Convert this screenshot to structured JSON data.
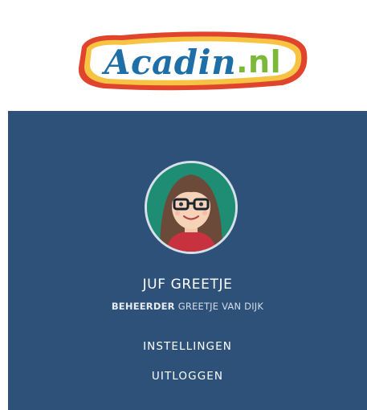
{
  "logo": {
    "brand_main": "Acadin",
    "brand_tld": ".nl"
  },
  "user": {
    "avatar_alt": "Juf Greetje avatar",
    "display_name": "JUF GREETJE",
    "role": "BEHEERDER",
    "full_name": "GREETJE VAN DIJK"
  },
  "menu": {
    "settings_label": "INSTELLINGEN",
    "logout_label": "UITLOGGEN"
  },
  "colors": {
    "panel_bg": "#2d5179",
    "logo_blue": "#1e6fa8",
    "logo_green": "#7cb83a",
    "logo_yellow": "#f6c342",
    "logo_red": "#e0442c"
  }
}
